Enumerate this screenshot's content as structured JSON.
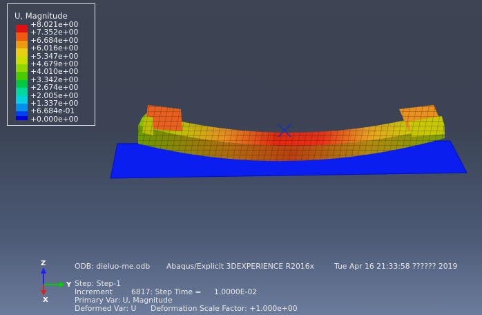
{
  "legend": {
    "title": "U, Magnitude",
    "values": [
      "+8.021e+00",
      "+7.352e+00",
      "+6.684e+00",
      "+6.016e+00",
      "+5.347e+00",
      "+4.679e+00",
      "+4.010e+00",
      "+3.342e+00",
      "+2.674e+00",
      "+2.005e+00",
      "+1.337e+00",
      "+6.684e-01",
      "+0.000e+00"
    ],
    "colors": [
      "#e01010",
      "#f05a10",
      "#f09a10",
      "#e8d010",
      "#c8e000",
      "#90d800",
      "#48cc00",
      "#00c840",
      "#00d8a0",
      "#00d0e0",
      "#0090f0",
      "#0040f0",
      "#0000d8"
    ]
  },
  "info": {
    "odb": "ODB: dieluo-me.odb",
    "version": "Abaqus/Explicit 3DEXPERIENCE R2016x",
    "date": "Tue Apr 16 21:33:58 ?????? 2019",
    "step": "Step: Step-1",
    "increment_label": "Increment",
    "increment_value": "6817: Step Time =",
    "step_time": "1.0000E-02",
    "primary_var": "Primary Var: U, Magnitude",
    "deformed_var": "Deformed Var: U",
    "scale_factor": "Deformation Scale Factor: +1.000e+00"
  },
  "triad": {
    "z": "Z",
    "y": "Y",
    "x": "X"
  }
}
